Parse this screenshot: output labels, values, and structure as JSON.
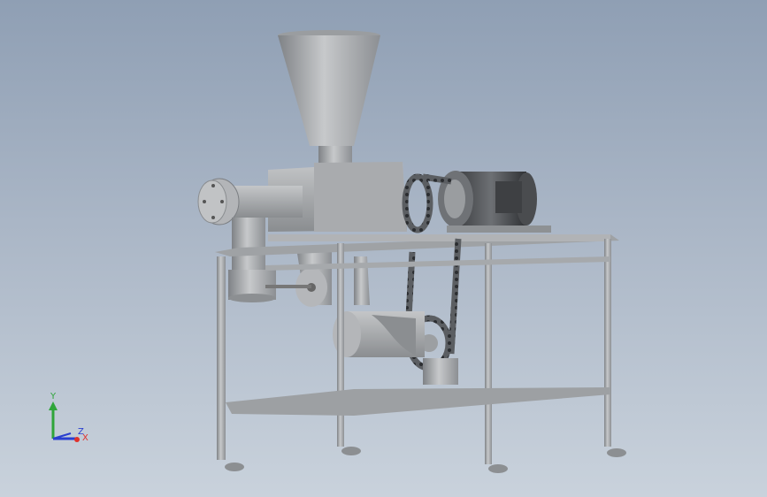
{
  "viewport": {
    "background_top": "#8f9fb4",
    "background_bottom": "#c9d2dc",
    "part_color": "#a9acaf",
    "chain_color": "#4a4c4f"
  },
  "triad": {
    "x_label": "X",
    "y_label": "Y",
    "z_label": "Z",
    "x_color": "#e0312b",
    "y_color": "#2fa53a",
    "z_color": "#2a3fd0"
  }
}
